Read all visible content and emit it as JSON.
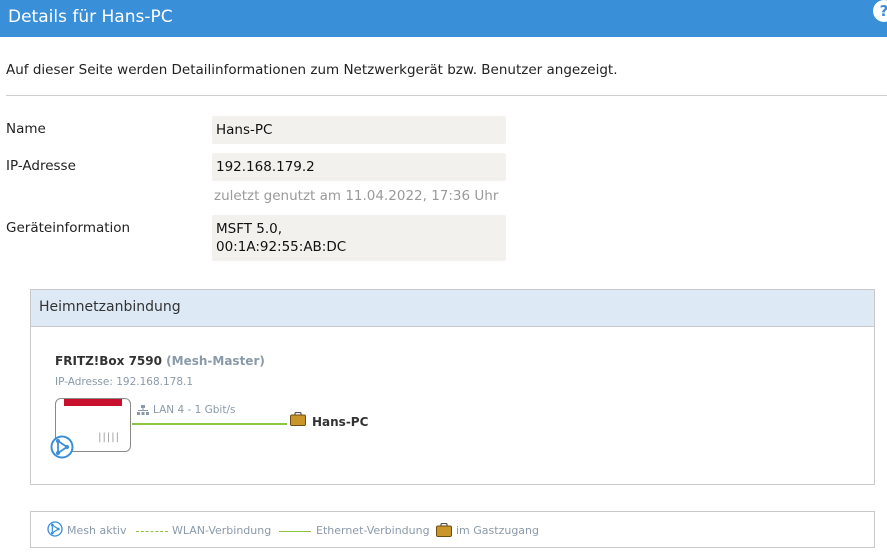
{
  "window": {
    "title": "Details für Hans-PC",
    "help_symbol": "?"
  },
  "intro_text": "Auf dieser Seite werden Detailinformationen zum Netzwerkgerät bzw. Benutzer angezeigt.",
  "fields": {
    "name": {
      "label": "Name",
      "value": "Hans-PC"
    },
    "ip": {
      "label": "IP-Adresse",
      "value": "192.168.179.2",
      "hint": "zuletzt genutzt am 11.04.2022, 17:36 Uhr"
    },
    "device_info": {
      "label": "Geräteinformation",
      "value_lines": [
        "MSFT 5.0,",
        "00:1A:92:55:AB:DC"
      ]
    }
  },
  "home_network": {
    "title": "Heimnetzanbindung",
    "box_name": "FRITZ!Box 7590",
    "box_role": "(Mesh-Master)",
    "box_ip": "IP-Adresse: 192.168.178.1",
    "link_label": "LAN 4 - 1 Gbit/s",
    "device_name": "Hans-PC",
    "colors": {
      "link": "#8cc63f",
      "router_accent": "#c8102e",
      "mesh": "#3a8fd9",
      "guest": "#b8860b"
    }
  },
  "legend": {
    "mesh": "Mesh aktiv",
    "wlan": "WLAN-Verbindung",
    "ethernet": "Ethernet-Verbindung",
    "guest": "im Gastzugang"
  },
  "icons": {
    "help": "help-icon",
    "mesh": "mesh-icon",
    "lan": "lan-icon",
    "guest": "guest-briefcase-icon"
  }
}
